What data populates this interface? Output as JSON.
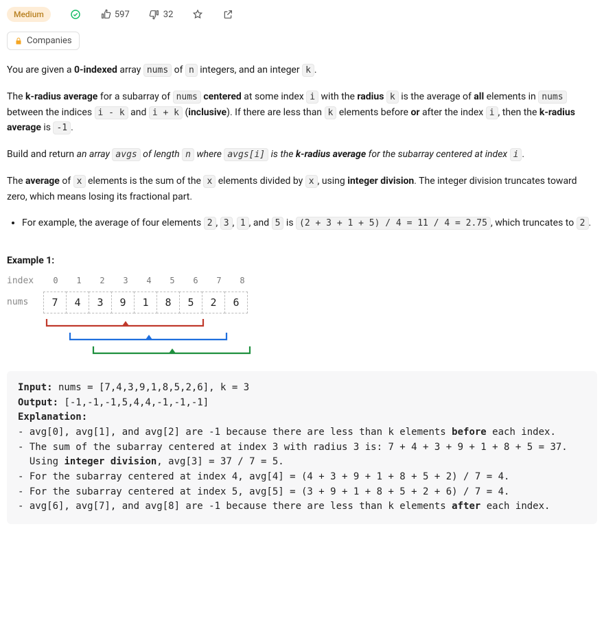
{
  "header": {
    "difficulty": "Medium",
    "upvotes": "597",
    "downvotes": "32",
    "companies_label": "Companies"
  },
  "prose": {
    "p1_a": "You are given a ",
    "p1_b": "0-indexed",
    "p1_c": " array ",
    "p1_code1": "nums",
    "p1_d": " of ",
    "p1_code2": "n",
    "p1_e": " integers, and an integer ",
    "p1_code3": "k",
    "p1_f": ".",
    "p2_a": "The ",
    "p2_b": "k-radius average",
    "p2_c": " for a subarray of ",
    "p2_code1": "nums",
    "p2_d": " ",
    "p2_e": "centered",
    "p2_f": " at some index ",
    "p2_code2": "i",
    "p2_g": " with the ",
    "p2_h": "radius",
    "p2_i": " ",
    "p2_code3": "k",
    "p2_j": " is the average of ",
    "p2_k": "all",
    "p2_l": " elements in ",
    "p2_code4": "nums",
    "p2_m": " between the indices ",
    "p2_code5": "i - k",
    "p2_n": " and ",
    "p2_code6": "i + k",
    "p2_o": " (",
    "p2_p": "inclusive",
    "p2_q": "). If there are less than ",
    "p2_code7": "k",
    "p2_r": " elements before ",
    "p2_s": "or",
    "p2_t": " after the index ",
    "p2_code8": "i",
    "p2_u": ", then the ",
    "p2_v": "k-radius average",
    "p2_w": " is ",
    "p2_code9": "-1",
    "p2_x": ".",
    "p3_a": "Build and return ",
    "p3_b": "an array ",
    "p3_code1": "avgs",
    "p3_c": " of length ",
    "p3_code2": "n",
    "p3_d": " where ",
    "p3_code3": "avgs[i]",
    "p3_e": " is the ",
    "p3_f": "k-radius average",
    "p3_g": " for the subarray centered at index ",
    "p3_code4": "i",
    "p3_h": ".",
    "p4_a": "The ",
    "p4_b": "average",
    "p4_c": " of ",
    "p4_code1": "x",
    "p4_d": " elements is the sum of the ",
    "p4_code2": "x",
    "p4_e": " elements divided by ",
    "p4_code3": "x",
    "p4_f": ", using ",
    "p4_g": "integer division",
    "p4_h": ". The integer division truncates toward zero, which means losing its fractional part.",
    "li1_a": "For example, the average of four elements ",
    "li1_code1": "2",
    "li1_b": ", ",
    "li1_code2": "3",
    "li1_c": ", ",
    "li1_code3": "1",
    "li1_d": ", and ",
    "li1_code4": "5",
    "li1_e": " is ",
    "li1_code5": "(2 + 3 + 1 + 5) / 4 = 11 / 4 = 2.75",
    "li1_f": ", which truncates to ",
    "li1_code6": "2",
    "li1_g": "."
  },
  "example": {
    "title": "Example 1:",
    "index_label": "index",
    "nums_label": "nums",
    "indices": [
      "0",
      "1",
      "2",
      "3",
      "4",
      "5",
      "6",
      "7",
      "8"
    ],
    "values": [
      "7",
      "4",
      "3",
      "9",
      "1",
      "8",
      "5",
      "2",
      "6"
    ],
    "code": {
      "l1a": "Input:",
      "l1b": " nums = [7,4,3,9,1,8,5,2,6], k = 3",
      "l2a": "Output:",
      "l2b": " [-1,-1,-1,5,4,4,-1,-1,-1]",
      "l3": "Explanation:",
      "l4a": "- avg[0], avg[1], and avg[2] are -1 because there are less than k elements ",
      "l4b": "before",
      "l4c": " each index.",
      "l5": "- The sum of the subarray centered at index 3 with radius 3 is: 7 + 4 + 3 + 9 + 1 + 8 + 5 = 37.",
      "l6a": "  Using ",
      "l6b": "integer division",
      "l6c": ", avg[3] = 37 / 7 = 5.",
      "l7": "- For the subarray centered at index 4, avg[4] = (4 + 3 + 9 + 1 + 8 + 5 + 2) / 7 = 4.",
      "l8": "- For the subarray centered at index 5, avg[5] = (3 + 9 + 1 + 8 + 5 + 2 + 6) / 7 = 4.",
      "l9a": "- avg[6], avg[7], and avg[8] are -1 because there are less than k elements ",
      "l9b": "after",
      "l9c": " each index."
    }
  }
}
